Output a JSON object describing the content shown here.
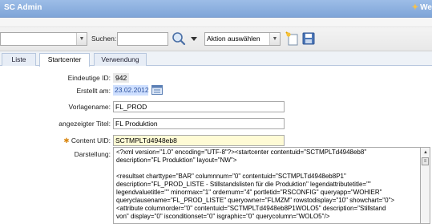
{
  "app": {
    "title": "SC Admin",
    "user_partial": "We"
  },
  "toolbar": {
    "search_label": "Suchen:",
    "search_value": "",
    "action_select": "Aktion auswählen"
  },
  "tabs": [
    {
      "label": "Liste"
    },
    {
      "label": "Startcenter"
    },
    {
      "label": "Verwendung"
    }
  ],
  "form": {
    "id_label": "Eindeutige ID:",
    "id_value": "942",
    "created_label": "Erstellt am:",
    "created_value": "23.02.2012",
    "template_label": "Vorlagename:",
    "template_value": "FL_PROD",
    "display_title_label": "angezeigter Titel:",
    "display_title_value": "FL Produktion",
    "content_uid_label": "Content UID:",
    "content_uid_value": "SCTMPLTd4948eb8",
    "representation_label": "Darstellung:",
    "xml_lines": [
      "<?xml version=\"1.0\" encoding=\"UTF-8\"?><startcenter contentuid=\"SCTMPLTd4948eb8\"",
      "description=\"FL Produktion\" layout=\"NW\">",
      "",
      "  <resultset charttype=\"BAR\" columnnum=\"0\" contentuid=\"SCTMPLTd4948eb8P1\"",
      "description=\"FL_PROD_LISTE - Stillstandslisten für die Produktion\" legendattributetitle=\"\"",
      "legendvaluetitle=\"\" minormax=\"1\" ordernum=\"4\" portletid=\"RSCONFIG\" queryapp=\"WOHIER\"",
      "queryclausename=\"FL_PROD_LISTE\" queryowner=\"FLMZM\" rowstodisplay=\"10\" showchart=\"0\">",
      "    <attribute columnorder=\"0\" contentuid=\"SCTMPLTd4948eb8P1WOLO5\" description=\"Stillstand",
      "von\" display=\"0\" isconditionset=\"0\" isgraphic=\"0\" querycolumn=\"WOLO5\"/>"
    ]
  }
}
